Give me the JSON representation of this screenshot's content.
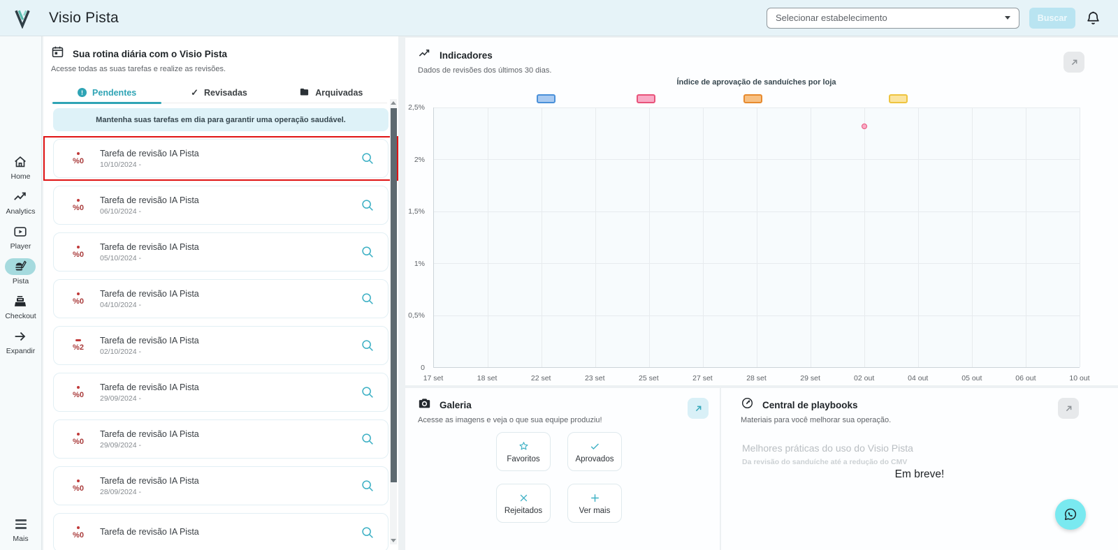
{
  "header": {
    "title": "Visio Pista",
    "select_placeholder": "Selecionar estabelecimento",
    "search_label": "Buscar"
  },
  "sidebar": {
    "items": [
      {
        "id": "home",
        "icon": "home",
        "label": "Home",
        "active": false
      },
      {
        "id": "analytics",
        "icon": "analytics",
        "label": "Analytics",
        "active": false
      },
      {
        "id": "player",
        "icon": "player",
        "label": "Player",
        "active": false
      },
      {
        "id": "pista",
        "icon": "pista",
        "label": "Pista",
        "active": true
      },
      {
        "id": "checkout",
        "icon": "checkout",
        "label": "Checkout",
        "active": false
      },
      {
        "id": "expandir",
        "icon": "expand",
        "label": "Expandir",
        "active": false
      }
    ],
    "more_label": "Mais"
  },
  "tasks": {
    "title": "Sua rotina diária com o Visio Pista",
    "subtitle": "Acesse todas as suas tarefas e realize as revisões.",
    "tabs": [
      {
        "label": "Pendentes",
        "active": true
      },
      {
        "label": "Revisadas",
        "active": false
      },
      {
        "label": "Arquivadas",
        "active": false
      }
    ],
    "notice": "Mantenha suas tarefas em dia para garantir uma operação saudável.",
    "items": [
      {
        "marker": "dot",
        "badge": "%0",
        "title": "Tarefa de revisão IA Pista",
        "date": "10/10/2024 -",
        "highlighted": true
      },
      {
        "marker": "dot",
        "badge": "%0",
        "title": "Tarefa de revisão IA Pista",
        "date": "06/10/2024 -",
        "highlighted": false
      },
      {
        "marker": "dot",
        "badge": "%0",
        "title": "Tarefa de revisão IA Pista",
        "date": "05/10/2024 -",
        "highlighted": false
      },
      {
        "marker": "dot",
        "badge": "%0",
        "title": "Tarefa de revisão IA Pista",
        "date": "04/10/2024 -",
        "highlighted": false
      },
      {
        "marker": "dash",
        "badge": "%2",
        "title": "Tarefa de revisão IA Pista",
        "date": "02/10/2024 -",
        "highlighted": false
      },
      {
        "marker": "dot",
        "badge": "%0",
        "title": "Tarefa de revisão IA Pista",
        "date": "29/09/2024 -",
        "highlighted": false
      },
      {
        "marker": "dot",
        "badge": "%0",
        "title": "Tarefa de revisão IA Pista",
        "date": "29/09/2024 -",
        "highlighted": false
      },
      {
        "marker": "dot",
        "badge": "%0",
        "title": "Tarefa de revisão IA Pista",
        "date": "28/09/2024 -",
        "highlighted": false
      },
      {
        "marker": "dot",
        "badge": "%0",
        "title": "Tarefa de revisão IA Pista",
        "date": "",
        "highlighted": false
      }
    ]
  },
  "indicators": {
    "title": "Indicadores",
    "subtitle": "Dados de revisões dos últimos 30 dias."
  },
  "chart_data": {
    "type": "scatter",
    "title": "Índice de aprovação de sanduíches por loja",
    "xlabel": "",
    "ylabel": "",
    "ylim": [
      0,
      2.5
    ],
    "grid": true,
    "legend_position": "top",
    "categories": [
      "17 set",
      "18 set",
      "22 set",
      "23 set",
      "25 set",
      "27 set",
      "28 set",
      "29 set",
      "02 out",
      "04 out",
      "05 out",
      "06 out",
      "10 out"
    ],
    "yticks": [
      {
        "value": 0,
        "label": "0"
      },
      {
        "value": 0.5,
        "label": "0,5%"
      },
      {
        "value": 1,
        "label": "1%"
      },
      {
        "value": 1.5,
        "label": "1,5%"
      },
      {
        "value": 2,
        "label": "2%"
      },
      {
        "value": 2.5,
        "label": "2,5%"
      }
    ],
    "series": [
      {
        "label": "",
        "color": "#a9caf1",
        "border": "#4a90d9",
        "legend_x_pct": 16,
        "points": []
      },
      {
        "label": "",
        "color": "#f9abc6",
        "border": "#e8537a",
        "legend_x_pct": 31.5,
        "points": [
          {
            "x": "02 out",
            "y": 2.32
          }
        ]
      },
      {
        "label": "",
        "color": "#f7c083",
        "border": "#e78a2e",
        "legend_x_pct": 48,
        "points": []
      },
      {
        "label": "",
        "color": "#fbe49e",
        "border": "#eec43f",
        "legend_x_pct": 70.5,
        "points": []
      }
    ]
  },
  "gallery": {
    "title": "Galeria",
    "subtitle": "Acesse as imagens e veja o que sua equipe produziu!",
    "buttons": [
      {
        "icon": "star",
        "label": "Favoritos"
      },
      {
        "icon": "check",
        "label": "Aprovados"
      },
      {
        "icon": "x",
        "label": "Rejeitados"
      },
      {
        "icon": "plus",
        "label": "Ver mais"
      }
    ]
  },
  "playbooks": {
    "title": "Central de playbooks",
    "subtitle": "Materiais para você melhorar sua operação.",
    "card_title": "Melhores práticas do uso do Visio Pista",
    "card_subtitle": "Da revisão do sanduíche até a redução do CMV",
    "coming_soon": "Em breve!"
  },
  "colors": {
    "accent_teal": "#2fa4b5",
    "header_bg": "#e6f3f8",
    "active_pill": "#a5dade",
    "badge_red": "#a93b3b",
    "annotation_red": "#e01313",
    "notice_bg": "#def2f8",
    "whatsapp_bg": "#79e9f0",
    "search_button_bg": "#b9e4f1"
  }
}
